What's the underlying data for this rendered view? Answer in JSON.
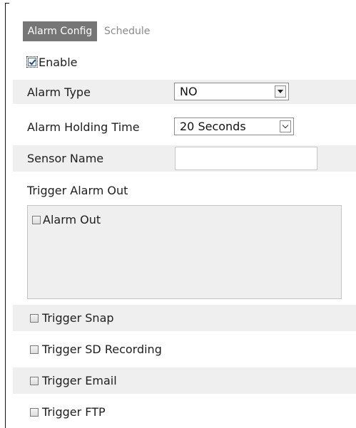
{
  "tabs": [
    {
      "label": "Alarm Config",
      "active": true
    },
    {
      "label": "Schedule",
      "active": false
    }
  ],
  "enable": {
    "label": "Enable",
    "checked": true
  },
  "alarm_type": {
    "label": "Alarm Type",
    "value": "NO"
  },
  "holding_time": {
    "label": "Alarm Holding Time",
    "value": "20 Seconds"
  },
  "sensor_name": {
    "label": "Sensor Name",
    "value": ""
  },
  "trigger_alarm_out": {
    "label": "Trigger Alarm Out",
    "alarm_out_label": "Alarm Out",
    "alarm_out_checked": false
  },
  "trigger_snap": {
    "label": "Trigger Snap",
    "checked": false
  },
  "trigger_sd_recording": {
    "label": "Trigger SD Recording",
    "checked": false
  },
  "trigger_email": {
    "label": "Trigger Email",
    "checked": false
  },
  "trigger_ftp": {
    "label": "Trigger FTP",
    "checked": false
  },
  "colors": {
    "active_tab": "#767676",
    "row_shade": "#efefef",
    "inactive_tab_text": "#8a8a8a"
  }
}
